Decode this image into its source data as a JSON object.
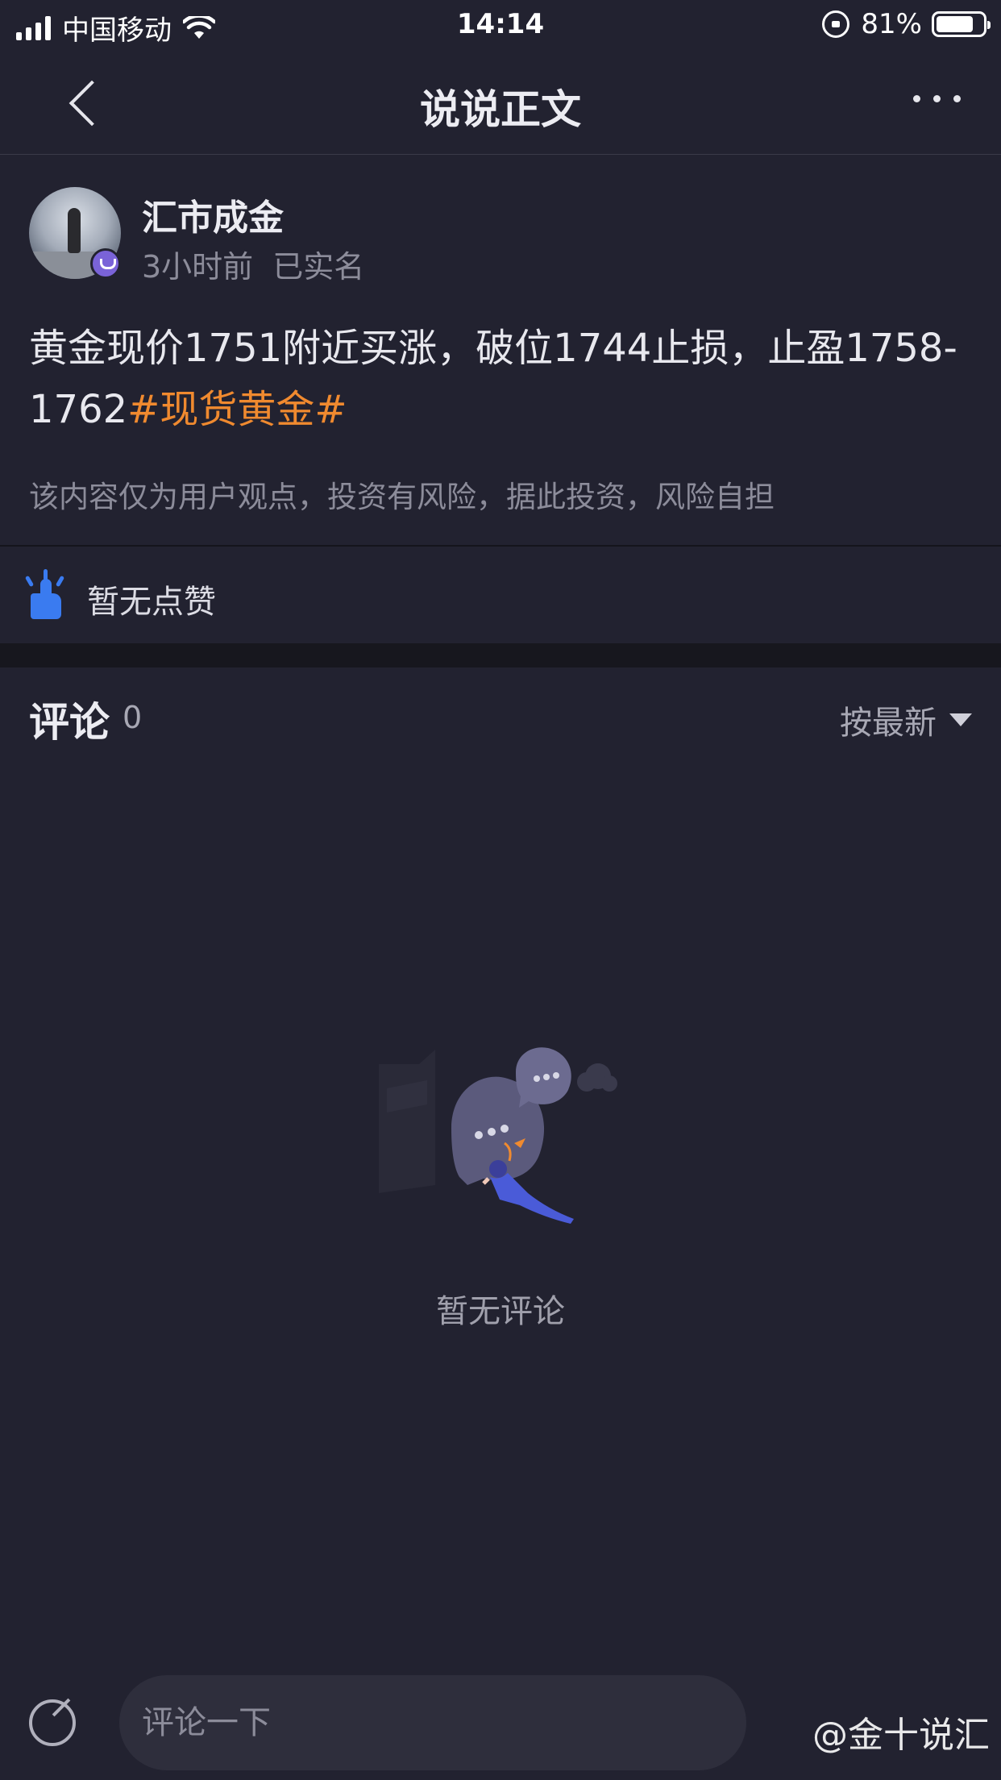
{
  "status_bar": {
    "carrier": "中国移动",
    "time": "14:14",
    "battery_percent": "81%",
    "battery_level": 0.81
  },
  "nav": {
    "title": "说说正文",
    "back_icon": "chevron-left-icon",
    "more_icon": "more-dots-icon"
  },
  "post": {
    "author_name": "汇市成金",
    "time_ago": "3小时前",
    "verified_label": "已实名",
    "text_main": "黄金现价1751附近买涨，破位1744止损，止盈1758-1762",
    "hashtag": "#现货黄金#",
    "disclaimer": "该内容仅为用户观点，投资有风险，据此投资，风险自担"
  },
  "likes": {
    "icon": "thumbs-up-icon",
    "text": "暂无点赞"
  },
  "comments": {
    "title": "评论",
    "count": "0",
    "sort_label": "按最新",
    "empty_text": "暂无评论"
  },
  "bottom_bar": {
    "compose_icon": "compose-icon",
    "input_placeholder": "评论一下",
    "watermark": "@金十说汇"
  },
  "colors": {
    "background": "#222230",
    "accent_hashtag": "#f08a2f",
    "like_icon_blue": "#3a7bf0",
    "vip_badge": "#7a63d8"
  }
}
